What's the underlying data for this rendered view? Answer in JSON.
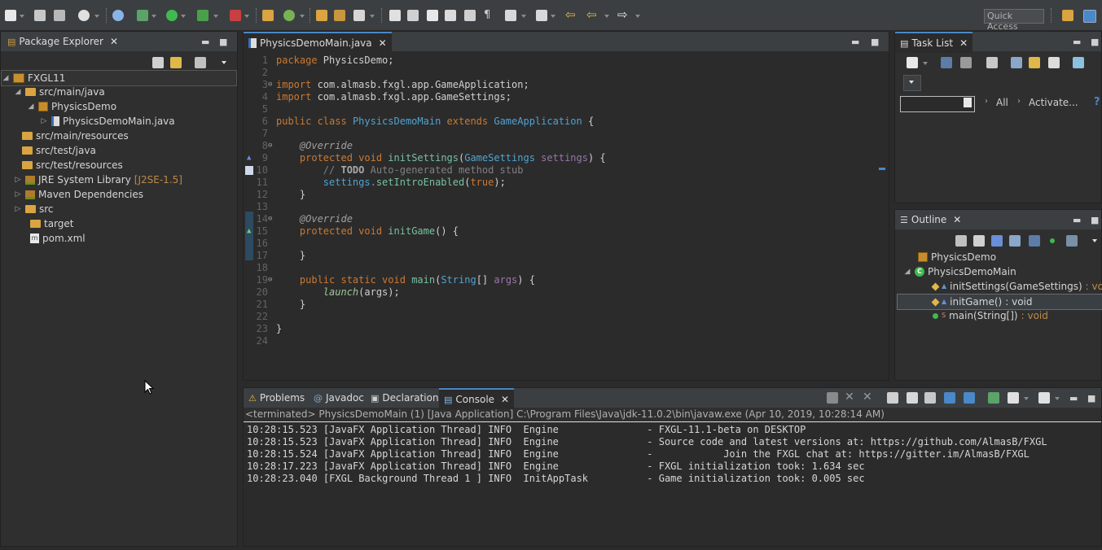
{
  "toolbar": {
    "quick_access_placeholder": "Quick Access"
  },
  "package_explorer": {
    "tab_label": "Package Explorer",
    "close": "✕",
    "tree": [
      {
        "label": "FXGL11",
        "icon": "project-icon",
        "twisty": "◢"
      },
      {
        "label": "src/main/java",
        "icon": "source-folder-icon",
        "twisty": "◢"
      },
      {
        "label": "PhysicsDemo",
        "icon": "package-icon",
        "twisty": "◢"
      },
      {
        "label": "PhysicsDemoMain.java",
        "icon": "java-file-icon",
        "twisty": "▷"
      },
      {
        "label": "src/main/resources",
        "icon": "source-folder-icon",
        "twisty": ""
      },
      {
        "label": "src/test/java",
        "icon": "source-folder-icon",
        "twisty": ""
      },
      {
        "label": "src/test/resources",
        "icon": "source-folder-icon",
        "twisty": ""
      },
      {
        "label": "JRE System Library",
        "decoration": "[J2SE-1.5]",
        "icon": "library-icon",
        "twisty": "▷"
      },
      {
        "label": "Maven Dependencies",
        "icon": "library-icon",
        "twisty": "▷"
      },
      {
        "label": "src",
        "icon": "folder-icon",
        "twisty": "▷"
      },
      {
        "label": "target",
        "icon": "folder-icon",
        "twisty": ""
      },
      {
        "label": "pom.xml",
        "icon": "xml-file-icon",
        "twisty": ""
      }
    ]
  },
  "editor": {
    "tab_label": "PhysicsDemoMain.java",
    "close": "✕",
    "line_numbers": [
      "1",
      "2",
      "3",
      "4",
      "5",
      "6",
      "7",
      "8",
      "9",
      "10",
      "11",
      "12",
      "13",
      "14",
      "15",
      "16",
      "17",
      "18",
      "19",
      "20",
      "21",
      "22",
      "23",
      "24"
    ],
    "lines": {
      "l1_kw": "package",
      "l1_rest": " PhysicsDemo;",
      "l3_kw": "import",
      "l3_rest": " com.almasb.fxgl.app.GameApplication;",
      "l4_kw": "import",
      "l4_rest": " com.almasb.fxgl.app.GameSettings;",
      "l6_kw": "public class",
      "l6_cls": "PhysicsDemoMain",
      "l6_kw2": "extends",
      "l6_cls2": "GameApplication",
      "l6_end": " {",
      "l8_ann": "@Override",
      "l9_kw": "protected void",
      "l9_meth": "initSettings",
      "l9_p1": "(",
      "l9_type": "GameSettings",
      "l9_param": "settings",
      "l9_end": ") {",
      "l10_cmt1": "// ",
      "l10_todo": "TODO",
      "l10_cmt2": " Auto-generated method stub",
      "l11_a": "settings.",
      "l11_meth": "setIntroEnabled",
      "l11_p": "(",
      "l11_kw": "true",
      "l11_end": ");",
      "l12": "}",
      "l14_ann": "@Override",
      "l15_kw": "protected void",
      "l15_meth": "initGame",
      "l15_end": "() {",
      "l17": "}",
      "l19_kw": "public static void",
      "l19_meth": "main",
      "l19_p": "(",
      "l19_type": "String",
      "l19_arr": "[] ",
      "l19_param": "args",
      "l19_end": ") {",
      "l20_meth": "launch",
      "l20_end": "(args);",
      "l21": "}",
      "l23": "}"
    }
  },
  "task_list": {
    "tab_label": "Task List",
    "close": "✕",
    "filter_all": "All",
    "filter_activate": "Activate..."
  },
  "outline": {
    "tab_label": "Outline",
    "close": "✕",
    "items": [
      {
        "label": "PhysicsDemo",
        "suffix": ""
      },
      {
        "label": "PhysicsDemoMain",
        "suffix": ""
      },
      {
        "label": "initSettings(GameSettings)",
        "suffix": " : void"
      },
      {
        "label": "initGame()",
        "suffix": " : void"
      },
      {
        "label": "main(String[])",
        "suffix": " : void"
      }
    ]
  },
  "bottom_tabs": {
    "problems": "Problems",
    "javadoc": "Javadoc",
    "declaration": "Declaration",
    "console": "Console",
    "close": "✕"
  },
  "console": {
    "header": "<terminated> PhysicsDemoMain (1) [Java Application] C:\\Program Files\\Java\\jdk-11.0.2\\bin\\javaw.exe (Apr 10, 2019, 10:28:14 AM)",
    "lines": [
      "10:28:15.523 [JavaFX Application Thread] INFO  Engine               - FXGL-11.1-beta on DESKTOP",
      "10:28:15.523 [JavaFX Application Thread] INFO  Engine               - Source code and latest versions at: https://github.com/AlmasB/FXGL",
      "10:28:15.524 [JavaFX Application Thread] INFO  Engine               -            Join the FXGL chat at: https://gitter.im/AlmasB/FXGL",
      "10:28:17.223 [JavaFX Application Thread] INFO  Engine               - FXGL initialization took: 1.634 sec",
      "10:28:23.040 [FXGL Background Thread 1 ] INFO  InitAppTask          - Game initialization took: 0.005 sec"
    ]
  },
  "colors": {
    "background": "#2b2b2b",
    "keyword": "#cc7832",
    "class": "#4fa3d1",
    "method": "#78c0a0"
  }
}
